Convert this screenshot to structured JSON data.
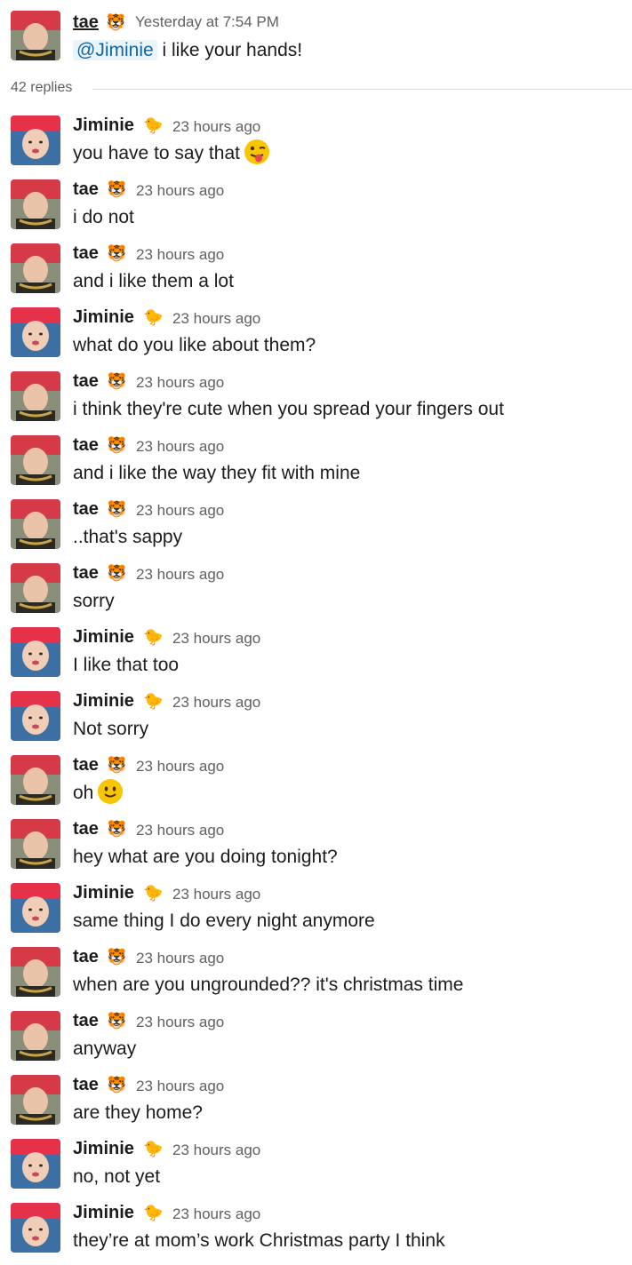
{
  "parent_message": {
    "author": "tae",
    "author_badge": "tiger-emoji",
    "timestamp": "Yesterday at 7:54 PM",
    "mention": "@Jiminie",
    "text": "i like your hands!"
  },
  "thread": {
    "reply_count_label": "42 replies"
  },
  "colors": {
    "text": "#1d1c1d",
    "muted": "#616061",
    "mention_bg": "#eaf5fb",
    "mention_fg": "#1264a3",
    "divider": "#dddddd"
  },
  "replies": [
    {
      "author": "Jiminie",
      "badge": "chick-emoji",
      "timestamp": "23 hours ago",
      "text": "you have to say that",
      "emoji": "winking-face-with-tongue"
    },
    {
      "author": "tae",
      "badge": "tiger-emoji",
      "timestamp": "23 hours ago",
      "text": "i do not"
    },
    {
      "author": "tae",
      "badge": "tiger-emoji",
      "timestamp": "23 hours ago",
      "text": "and i like them a lot"
    },
    {
      "author": "Jiminie",
      "badge": "chick-emoji",
      "timestamp": "23 hours ago",
      "text": "what do you like about them?"
    },
    {
      "author": "tae",
      "badge": "tiger-emoji",
      "timestamp": "23 hours ago",
      "text": "i think they're cute when you spread your fingers out"
    },
    {
      "author": "tae",
      "badge": "tiger-emoji",
      "timestamp": "23 hours ago",
      "text": "and i like the way they fit with mine"
    },
    {
      "author": "tae",
      "badge": "tiger-emoji",
      "timestamp": "23 hours ago",
      "text": "..that's sappy"
    },
    {
      "author": "tae",
      "badge": "tiger-emoji",
      "timestamp": "23 hours ago",
      "text": "sorry"
    },
    {
      "author": "Jiminie",
      "badge": "chick-emoji",
      "timestamp": "23 hours ago",
      "text": "I like that too"
    },
    {
      "author": "Jiminie",
      "badge": "chick-emoji",
      "timestamp": "23 hours ago",
      "text": "Not sorry"
    },
    {
      "author": "tae",
      "badge": "tiger-emoji",
      "timestamp": "23 hours ago",
      "text": "oh",
      "emoji": "slightly-smiling-face"
    },
    {
      "author": "tae",
      "badge": "tiger-emoji",
      "timestamp": "23 hours ago",
      "text": "hey what are you doing tonight?"
    },
    {
      "author": "Jiminie",
      "badge": "chick-emoji",
      "timestamp": "23 hours ago",
      "text": "same thing I do every night anymore"
    },
    {
      "author": "tae",
      "badge": "tiger-emoji",
      "timestamp": "23 hours ago",
      "text": "when are you ungrounded?? it's christmas time"
    },
    {
      "author": "tae",
      "badge": "tiger-emoji",
      "timestamp": "23 hours ago",
      "text": "anyway"
    },
    {
      "author": "tae",
      "badge": "tiger-emoji",
      "timestamp": "23 hours ago",
      "text": "are they home?"
    },
    {
      "author": "Jiminie",
      "badge": "chick-emoji",
      "timestamp": "23 hours ago",
      "text": "no, not yet"
    },
    {
      "author": "Jiminie",
      "badge": "chick-emoji",
      "timestamp": "23 hours ago",
      "text": "they’re at mom’s work Christmas party I think"
    }
  ]
}
